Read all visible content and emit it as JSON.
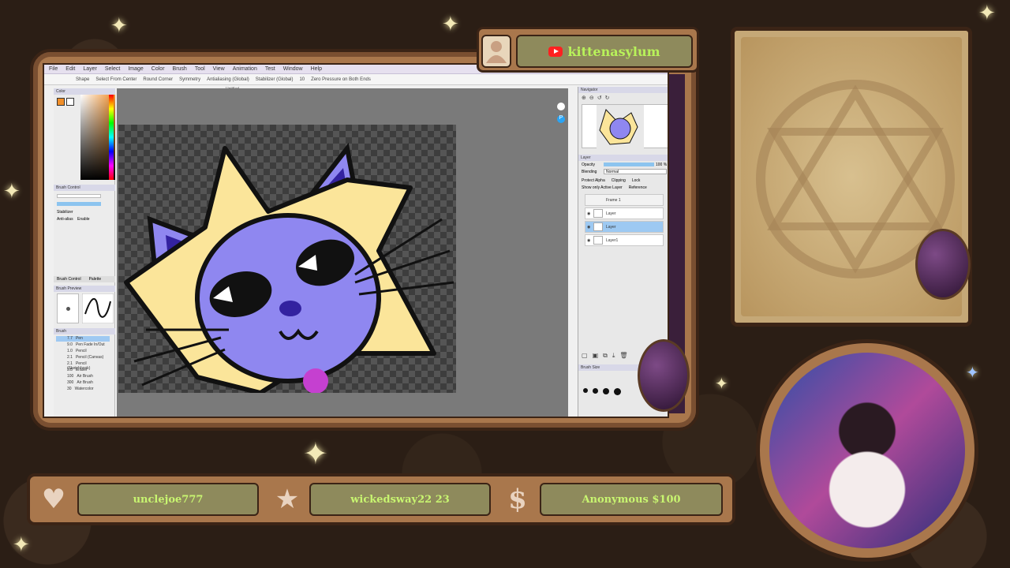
{
  "stream": {
    "channel_name": "kittenasylum",
    "platform_icon": "youtube-icon"
  },
  "app": {
    "menu": [
      "File",
      "Edit",
      "Layer",
      "Select",
      "Image",
      "Color",
      "Brush",
      "Tool",
      "View",
      "Animation",
      "Test",
      "Window",
      "Help"
    ],
    "toolbar": {
      "shape_label": "Shape",
      "select_from_center": "Select From Center",
      "round_corner": "Round Corner",
      "symmetry_label": "Symmetry",
      "antialiasing": "Antialiasing (Global)",
      "stabilizer": "Stabilizer (Global)",
      "stabilizer_value": "10",
      "zero_pressure": "Zero Pressure on Both Ends"
    },
    "document_title": "Untitled",
    "left_panel": {
      "color_header": "Color",
      "brush_control_header": "Brush Control",
      "stabilizer_label": "Stabilizer",
      "anti_alias_label": "Anti-alias",
      "anti_alias_value": "Enable",
      "brush_preview_header": "Brush Preview",
      "brush_header": "Brush",
      "tabs": [
        "Brush Control",
        "Palette"
      ],
      "brushes": [
        {
          "size": "7.7",
          "name": "Pen",
          "selected": true
        },
        {
          "size": "9.0",
          "name": "Pen Fade In/Out",
          "selected": false
        },
        {
          "size": "1.0",
          "name": "Pencil",
          "selected": false
        },
        {
          "size": "2.1",
          "name": "Pencil (Canvas)",
          "selected": false
        },
        {
          "size": "2.1",
          "name": "Pencil (Sketchbook)",
          "selected": false
        },
        {
          "size": "3.8",
          "name": "Eraser",
          "selected": false
        },
        {
          "size": "100",
          "name": "Air Brush",
          "selected": false
        },
        {
          "size": "300",
          "name": "Air Brush",
          "selected": false
        },
        {
          "size": "30",
          "name": "Watercolor",
          "selected": false
        }
      ]
    },
    "right_panel": {
      "navigator_header": "Navigator",
      "layer_header": "Layer",
      "opacity_label": "Opacity",
      "opacity_value": "100 %",
      "blending_label": "Blending",
      "blending_value": "Normal",
      "protect_alpha": "Protect Alpha",
      "clipping": "Clipping",
      "lock": "Lock",
      "show_only_active": "Show only Active Layer",
      "reference": "Reference",
      "folder_name": "Frame 1",
      "layers": [
        {
          "name": "Layer",
          "selected": false
        },
        {
          "name": "Layer",
          "selected": true
        },
        {
          "name": "Layer1",
          "selected": false
        }
      ],
      "brush_size_header": "Brush Size"
    }
  },
  "alerts": [
    {
      "icon": "heart-icon",
      "text": "unclejoe777"
    },
    {
      "icon": "star-icon",
      "text": "wickedsway22 23"
    },
    {
      "icon": "dollar-icon",
      "text": "Anonymous $100"
    }
  ],
  "colors": {
    "frame_wood": "#a9774c",
    "frame_dark": "#3b2416",
    "plate": "#8e8a5c",
    "plate_text": "#c8f570",
    "character_body": "#8f87f0",
    "character_mane": "#fbe59a"
  }
}
